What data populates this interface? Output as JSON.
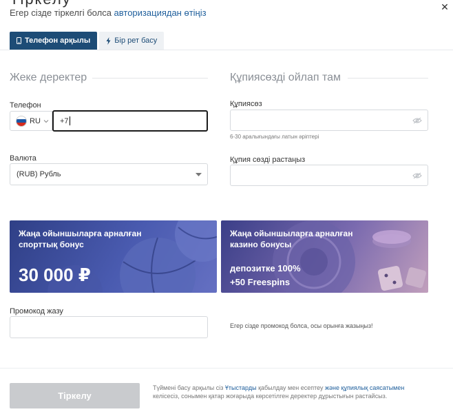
{
  "header": {
    "title_sliver": "Тіркелу",
    "login_prompt": "Егер сізде тіркелгі болса ",
    "login_link": "авторизациядан өтіңіз",
    "close_glyph": "✕"
  },
  "tabs": [
    {
      "label": "Телефон арқылы",
      "icon": "phone-icon",
      "active": true
    },
    {
      "label": "Бір рет басу",
      "icon": "lightning-icon",
      "active": false
    }
  ],
  "personal": {
    "section_title": "Жеке деректер",
    "phone_label": "Телефон",
    "country_code": "RU",
    "phone_value": "+7",
    "currency_label": "Валюта",
    "currency_value": "(RUB) Рубль"
  },
  "password": {
    "section_title": "Құпиясөзді ойлап там",
    "password_label": "Құпиясөз",
    "password_hint": "6-30 аралығындағы латын әріптері",
    "confirm_label": "Құпия сөзді растаңыз"
  },
  "promos": {
    "sport_title": "Жаңа ойыншыларға арналған спорттық бонус",
    "sport_amount": "30 000 ₽",
    "casino_title": "Жаңа ойыншыларға арналған казино бонусы",
    "casino_line1": "депозитке 100%",
    "casino_line2": "+50 Freespins"
  },
  "promo_code": {
    "label": "Промокод жазу",
    "hint": "Егер сізде промокод болса, осы орынға жазыңыз!"
  },
  "footer": {
    "register_label": "Тіркелу",
    "terms_part1": "Түймені басу арқылы сіз ",
    "terms_link1": "Ұтыстарды",
    "terms_part2": " қабылдау мен есептеу ",
    "terms_link2": "және құпиялық саясатымен",
    "terms_part3": " келісесіз, сонымен қатар жоғарыда көрсетілген деректер дұрыстығын растайсыз."
  },
  "colors": {
    "accent": "#1d4c76",
    "link": "#1f5f9c",
    "button_disabled": "#c9cbce"
  }
}
